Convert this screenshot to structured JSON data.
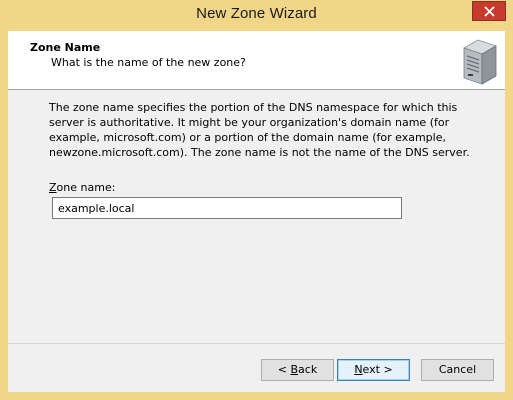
{
  "window": {
    "title": "New Zone Wizard",
    "frame_color": "#f1d589",
    "close_button_color": "#c73b2e",
    "close_icon": "close-icon"
  },
  "header": {
    "title": "Zone Name",
    "subtitle": "What is the name of the new zone?",
    "icon": "server-icon"
  },
  "body": {
    "description": "The zone name specifies the portion of the DNS namespace for which this server is authoritative. It might be your organization's domain name (for example, microsoft.com) or a portion of the domain name (for example, newzone.microsoft.com). The zone name is not the name of the DNS server."
  },
  "zone_name": {
    "label_prefix": "Z",
    "label_rest": "one name:",
    "value": "example.local"
  },
  "buttons": {
    "back_prefix": "< ",
    "back_mnemonic": "B",
    "back_rest": "ack",
    "next_mnemonic": "N",
    "next_rest": "ext >",
    "cancel": "Cancel"
  }
}
